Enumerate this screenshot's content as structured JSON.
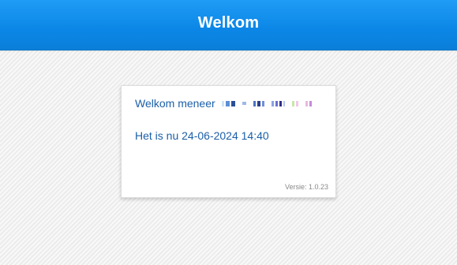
{
  "header": {
    "title": "Welkom"
  },
  "card": {
    "greeting": "Welkom meneer",
    "datetime_prefix": "Het is nu",
    "datetime_value": "24-06-2024 14:40",
    "version": "Versie: 1.0.23"
  },
  "colors": {
    "header_blue": "#0b86e6",
    "text_blue": "#1b5fa8",
    "version_gray": "#888888"
  }
}
